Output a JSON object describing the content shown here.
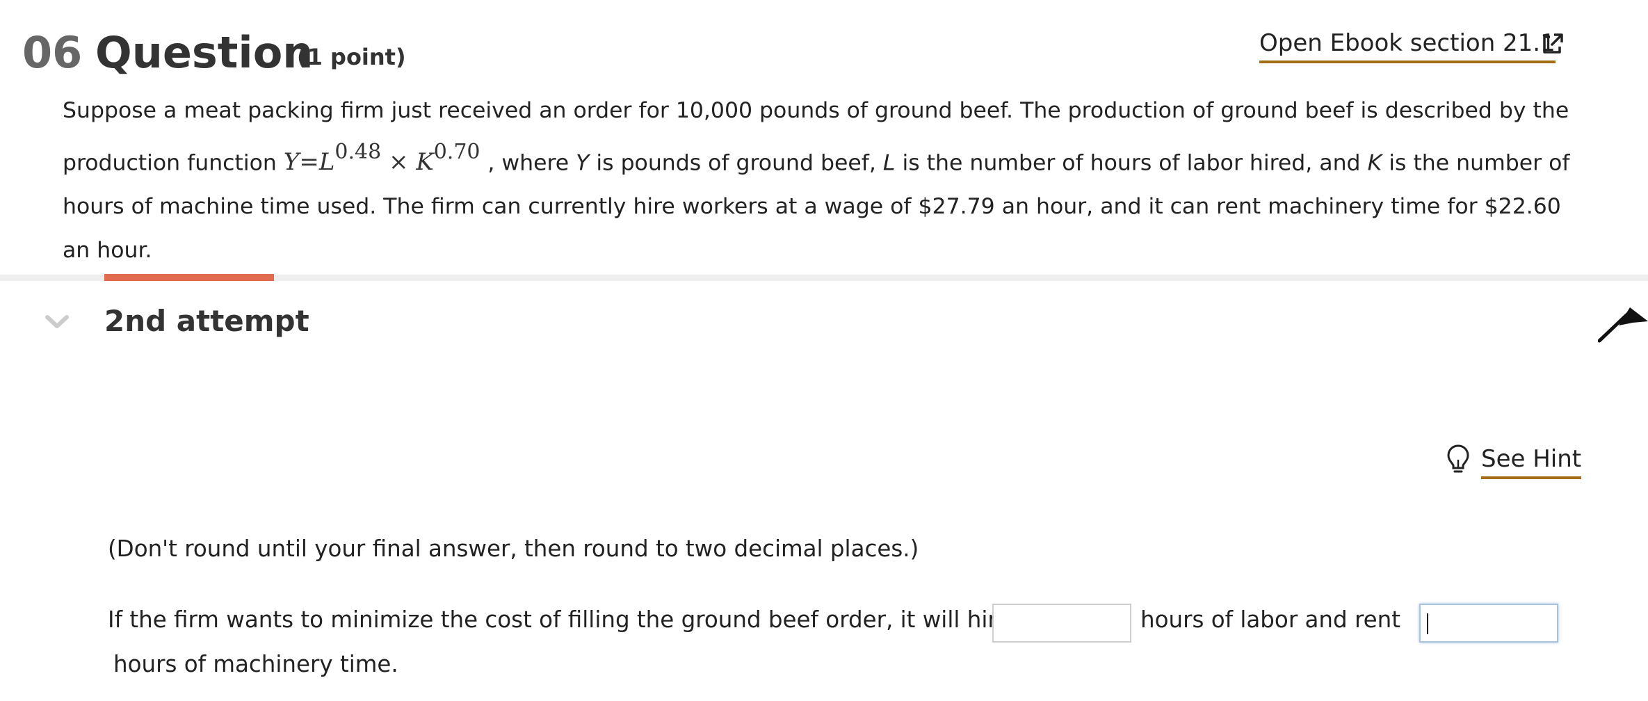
{
  "header": {
    "question_number": "06",
    "question_word": "Question",
    "points": "(1 point)",
    "ebook_link": "Open Ebook section 21.1",
    "ebook_icon": "external-link-icon"
  },
  "problem": {
    "part1": "Suppose a meat packing firm just received an order for 10,000 pounds of ground beef. The production of ground beef is described by the production function ",
    "formula": {
      "y": "Y",
      "eq": "=",
      "l": "L",
      "l_exp": "0.48",
      "times": "×",
      "k": "K",
      "k_exp": "0.70"
    },
    "part2": " , where ",
    "var_y": "Y",
    "part3": " is pounds of ground beef, ",
    "var_l": "L",
    "part4": " is the number of hours of labor hired, and ",
    "var_k": "K",
    "part5": " is the number of hours of machine time used. The firm can currently hire workers at a wage of $27.79  an hour, and it can rent machinery time for $22.60  an hour."
  },
  "progress": {
    "fraction": 0.07,
    "color": "#e06b4f"
  },
  "attempt": {
    "label": "2nd attempt",
    "chevron_icon": "chevron-down-icon",
    "collapse_icon": "collapse-arrow-icon"
  },
  "hint": {
    "label": "See Hint",
    "icon": "lightbulb-icon"
  },
  "instruction": "(Don't round until your final answer, then round to two decimal places.)",
  "answer": {
    "text_before": "If the firm wants to minimize the cost of filling the ground beef order, it will hire",
    "text_middle": "hours of labor and rent",
    "text_after": "hours of machinery time.",
    "labor_hours_value": "",
    "machine_hours_value": ""
  },
  "colors": {
    "accent_underline": "#a36d14",
    "progress": "#e06b4f",
    "divider": "#eeeeee"
  }
}
